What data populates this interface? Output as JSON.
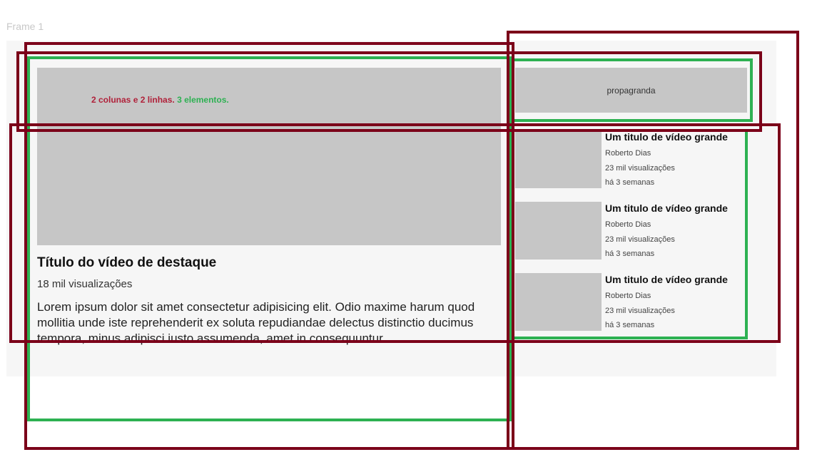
{
  "frame": {
    "label": "Frame 1"
  },
  "annotation": {
    "part1": "2 colunas e 2 linhas.",
    "part2": "3 elementos."
  },
  "feature": {
    "title": "Título do vídeo de destaque",
    "views": "18 mil visualizações",
    "description": "Lorem ipsum dolor sit amet consectetur adipisicing elit. Odio maxime harum quod mollitia unde iste reprehenderit ex soluta repudiandae delectus distinctio ducimus tempora, minus adipisci iusto assumenda, amet in consequuntur."
  },
  "ad": {
    "label": "propagranda"
  },
  "sidebar": {
    "items": [
      {
        "title": "Um titulo de vídeo grande",
        "author": "Roberto Dias",
        "views": "23  mil visualizações",
        "age": "há 3 semanas"
      },
      {
        "title": "Um titulo de vídeo grande",
        "author": "Roberto Dias",
        "views": "23  mil visualizações",
        "age": "há 3 semanas"
      },
      {
        "title": "Um titulo de vídeo grande",
        "author": "Roberto Dias",
        "views": "23  mil visualizações",
        "age": "há 3 semanas"
      }
    ]
  },
  "colors": {
    "red_outline": "#7b0019",
    "green_outline": "#2db152",
    "placeholder_gray": "#c6c6c6"
  }
}
